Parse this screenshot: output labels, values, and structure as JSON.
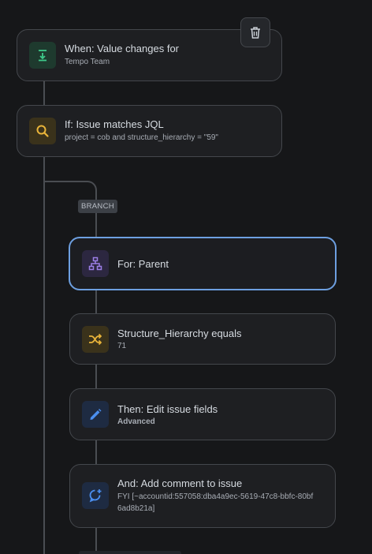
{
  "delete_button": {
    "icon": "trash-icon"
  },
  "trigger": {
    "title": "When: Value changes for",
    "subtitle": "Tempo Team",
    "icon": "download-arrow-icon",
    "icon_color": "#3ec98a",
    "icon_bg": "#1e3a2e"
  },
  "condition": {
    "title": "If: Issue matches JQL",
    "subtitle": "project = cob and structure_hierarchy = \"59\"",
    "icon": "search-icon",
    "icon_color": "#e9b43a",
    "icon_bg": "#3a321b"
  },
  "branch_label": "BRANCH",
  "branch": {
    "title": "For: Parent",
    "icon": "hierarchy-icon",
    "icon_color": "#9b7fe6",
    "icon_bg": "#2c2740",
    "accent": "#6d9fe0"
  },
  "steps": [
    {
      "title": "Structure_Hierarchy equals",
      "subtitle": "71",
      "icon": "shuffle-icon",
      "icon_color": "#e9b43a",
      "icon_bg": "#3a321b"
    },
    {
      "title": "Then: Edit issue fields",
      "subtitle": "Advanced",
      "icon": "pencil-icon",
      "icon_color": "#4b8ff0",
      "icon_bg": "#1e2b42"
    },
    {
      "title": "And: Add comment to issue",
      "subtitle": "FYI [~accountid:557058:dba4a9ec-5619-47c8-bbfc-80bf6ad8b21a]",
      "icon": "comment-add-icon",
      "icon_color": "#4b8ff0",
      "icon_bg": "#1e2b42"
    }
  ]
}
